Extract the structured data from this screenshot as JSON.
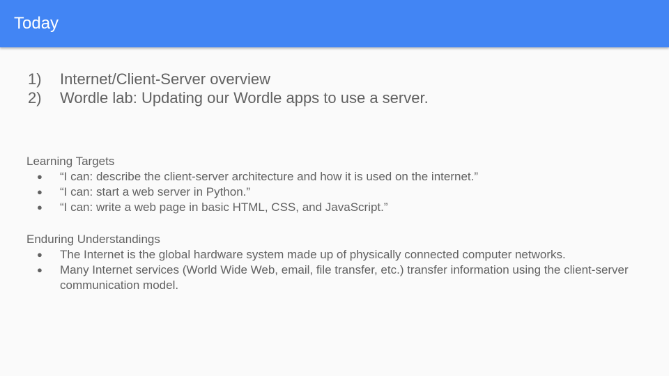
{
  "header": {
    "title": "Today",
    "color": "#4285f4"
  },
  "agenda": [
    {
      "num": "1)",
      "text": "Internet/Client-Server overview"
    },
    {
      "num": "2)",
      "text": "Wordle lab: Updating our Wordle apps to use a server."
    }
  ],
  "learning_targets": {
    "heading": "Learning Targets",
    "items": [
      "“I can: describe the client-server architecture and how it is used on the internet.”",
      "“I can: start a web server in Python.”",
      "“I can: write a web page in basic HTML, CSS, and JavaScript.”"
    ]
  },
  "enduring_understandings": {
    "heading": "Enduring Understandings",
    "items": [
      "The Internet is the global hardware system made up of physically connected computer networks.",
      "Many Internet services (World Wide Web, email, file transfer, etc.) transfer information using the client-server communication model."
    ]
  },
  "bullet_glyph": "●"
}
